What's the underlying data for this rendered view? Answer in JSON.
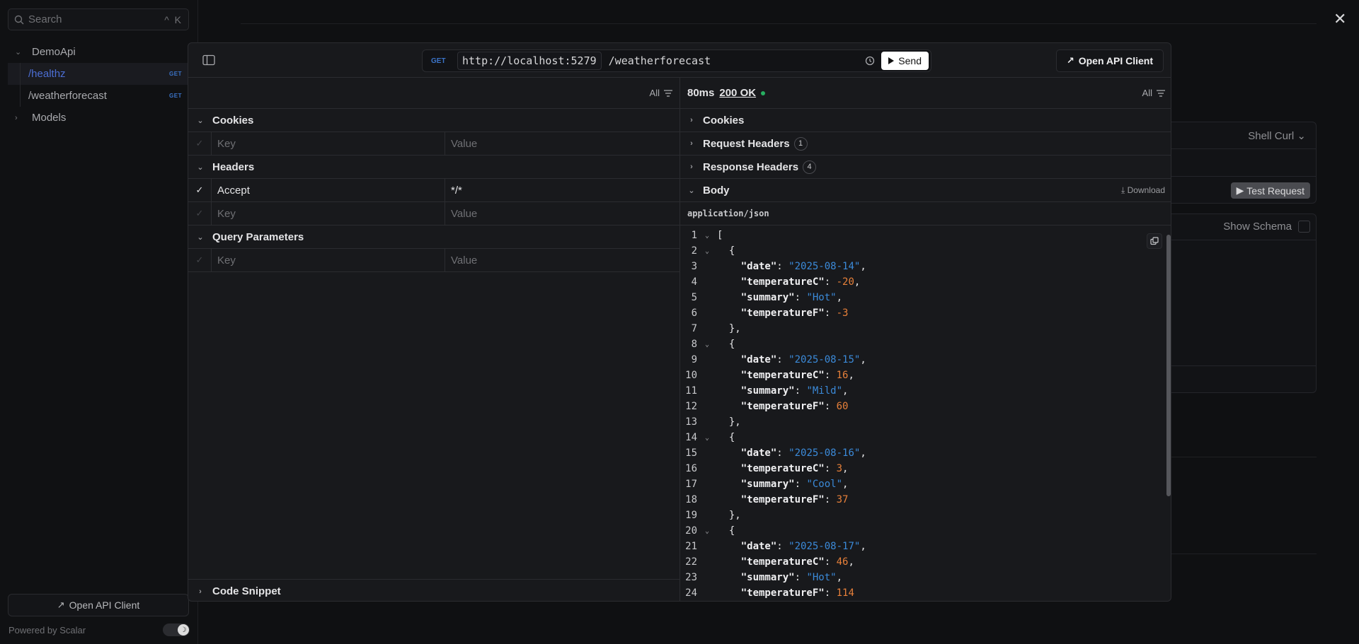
{
  "sidebar": {
    "search_placeholder": "Search",
    "search_shortcut": "^ K",
    "group_label": "DemoApi",
    "items": [
      {
        "label": "/healthz",
        "method": "GET"
      },
      {
        "label": "/weatherforecast",
        "method": "GET"
      }
    ],
    "models_label": "Models",
    "open_client_label": "Open API Client",
    "powered_by": "Powered by Scalar"
  },
  "background": {
    "shell_label": "Shell Curl",
    "test_request_label": "Test Request",
    "show_schema_label": "Show Schema"
  },
  "modal": {
    "method": "GET",
    "base_url": "http://localhost:5279",
    "path": "/weatherforecast",
    "send_label": "Send",
    "open_client_label": "Open API Client",
    "request": {
      "filter_label": "All",
      "cookies_label": "Cookies",
      "headers_label": "Headers",
      "query_label": "Query Parameters",
      "key_placeholder": "Key",
      "value_placeholder": "Value",
      "header_rows": [
        {
          "key": "Accept",
          "value": "*/*"
        }
      ],
      "code_snippet_label": "Code Snippet"
    },
    "response": {
      "time": "80ms",
      "status": "200 OK",
      "filter_label": "All",
      "cookies_label": "Cookies",
      "request_headers_label": "Request Headers",
      "request_headers_count": "1",
      "response_headers_label": "Response Headers",
      "response_headers_count": "4",
      "body_label": "Body",
      "download_label": "Download",
      "content_type": "application/json",
      "body_lines": [
        {
          "n": "1",
          "fold": true,
          "parts": [
            [
              "txt",
              "["
            ]
          ]
        },
        {
          "n": "2",
          "fold": true,
          "parts": [
            [
              "txt",
              "  {"
            ]
          ]
        },
        {
          "n": "3",
          "fold": false,
          "parts": [
            [
              "txt",
              "    "
            ],
            [
              "k",
              "\"date\""
            ],
            [
              "txt",
              ": "
            ],
            [
              "s",
              "\"2025-08-14\""
            ],
            [
              "txt",
              ","
            ]
          ]
        },
        {
          "n": "4",
          "fold": false,
          "parts": [
            [
              "txt",
              "    "
            ],
            [
              "k",
              "\"temperatureC\""
            ],
            [
              "txt",
              ": "
            ],
            [
              "n",
              "-20"
            ],
            [
              "txt",
              ","
            ]
          ]
        },
        {
          "n": "5",
          "fold": false,
          "parts": [
            [
              "txt",
              "    "
            ],
            [
              "k",
              "\"summary\""
            ],
            [
              "txt",
              ": "
            ],
            [
              "s",
              "\"Hot\""
            ],
            [
              "txt",
              ","
            ]
          ]
        },
        {
          "n": "6",
          "fold": false,
          "parts": [
            [
              "txt",
              "    "
            ],
            [
              "k",
              "\"temperatureF\""
            ],
            [
              "txt",
              ": "
            ],
            [
              "n",
              "-3"
            ]
          ]
        },
        {
          "n": "7",
          "fold": false,
          "parts": [
            [
              "txt",
              "  },"
            ]
          ]
        },
        {
          "n": "8",
          "fold": true,
          "parts": [
            [
              "txt",
              "  {"
            ]
          ]
        },
        {
          "n": "9",
          "fold": false,
          "parts": [
            [
              "txt",
              "    "
            ],
            [
              "k",
              "\"date\""
            ],
            [
              "txt",
              ": "
            ],
            [
              "s",
              "\"2025-08-15\""
            ],
            [
              "txt",
              ","
            ]
          ]
        },
        {
          "n": "10",
          "fold": false,
          "parts": [
            [
              "txt",
              "    "
            ],
            [
              "k",
              "\"temperatureC\""
            ],
            [
              "txt",
              ": "
            ],
            [
              "n",
              "16"
            ],
            [
              "txt",
              ","
            ]
          ]
        },
        {
          "n": "11",
          "fold": false,
          "parts": [
            [
              "txt",
              "    "
            ],
            [
              "k",
              "\"summary\""
            ],
            [
              "txt",
              ": "
            ],
            [
              "s",
              "\"Mild\""
            ],
            [
              "txt",
              ","
            ]
          ]
        },
        {
          "n": "12",
          "fold": false,
          "parts": [
            [
              "txt",
              "    "
            ],
            [
              "k",
              "\"temperatureF\""
            ],
            [
              "txt",
              ": "
            ],
            [
              "n",
              "60"
            ]
          ]
        },
        {
          "n": "13",
          "fold": false,
          "parts": [
            [
              "txt",
              "  },"
            ]
          ]
        },
        {
          "n": "14",
          "fold": true,
          "parts": [
            [
              "txt",
              "  {"
            ]
          ]
        },
        {
          "n": "15",
          "fold": false,
          "parts": [
            [
              "txt",
              "    "
            ],
            [
              "k",
              "\"date\""
            ],
            [
              "txt",
              ": "
            ],
            [
              "s",
              "\"2025-08-16\""
            ],
            [
              "txt",
              ","
            ]
          ]
        },
        {
          "n": "16",
          "fold": false,
          "parts": [
            [
              "txt",
              "    "
            ],
            [
              "k",
              "\"temperatureC\""
            ],
            [
              "txt",
              ": "
            ],
            [
              "n",
              "3"
            ],
            [
              "txt",
              ","
            ]
          ]
        },
        {
          "n": "17",
          "fold": false,
          "parts": [
            [
              "txt",
              "    "
            ],
            [
              "k",
              "\"summary\""
            ],
            [
              "txt",
              ": "
            ],
            [
              "s",
              "\"Cool\""
            ],
            [
              "txt",
              ","
            ]
          ]
        },
        {
          "n": "18",
          "fold": false,
          "parts": [
            [
              "txt",
              "    "
            ],
            [
              "k",
              "\"temperatureF\""
            ],
            [
              "txt",
              ": "
            ],
            [
              "n",
              "37"
            ]
          ]
        },
        {
          "n": "19",
          "fold": false,
          "parts": [
            [
              "txt",
              "  },"
            ]
          ]
        },
        {
          "n": "20",
          "fold": true,
          "parts": [
            [
              "txt",
              "  {"
            ]
          ]
        },
        {
          "n": "21",
          "fold": false,
          "parts": [
            [
              "txt",
              "    "
            ],
            [
              "k",
              "\"date\""
            ],
            [
              "txt",
              ": "
            ],
            [
              "s",
              "\"2025-08-17\""
            ],
            [
              "txt",
              ","
            ]
          ]
        },
        {
          "n": "22",
          "fold": false,
          "parts": [
            [
              "txt",
              "    "
            ],
            [
              "k",
              "\"temperatureC\""
            ],
            [
              "txt",
              ": "
            ],
            [
              "n",
              "46"
            ],
            [
              "txt",
              ","
            ]
          ]
        },
        {
          "n": "23",
          "fold": false,
          "parts": [
            [
              "txt",
              "    "
            ],
            [
              "k",
              "\"summary\""
            ],
            [
              "txt",
              ": "
            ],
            [
              "s",
              "\"Hot\""
            ],
            [
              "txt",
              ","
            ]
          ]
        },
        {
          "n": "24",
          "fold": false,
          "parts": [
            [
              "txt",
              "    "
            ],
            [
              "k",
              "\"temperatureF\""
            ],
            [
              "txt",
              ": "
            ],
            [
              "n",
              "114"
            ]
          ]
        }
      ]
    }
  },
  "colors": {
    "accent": "#3b74c9",
    "string": "#3b8ad9",
    "number": "#e7803a",
    "success": "#27ae60"
  }
}
